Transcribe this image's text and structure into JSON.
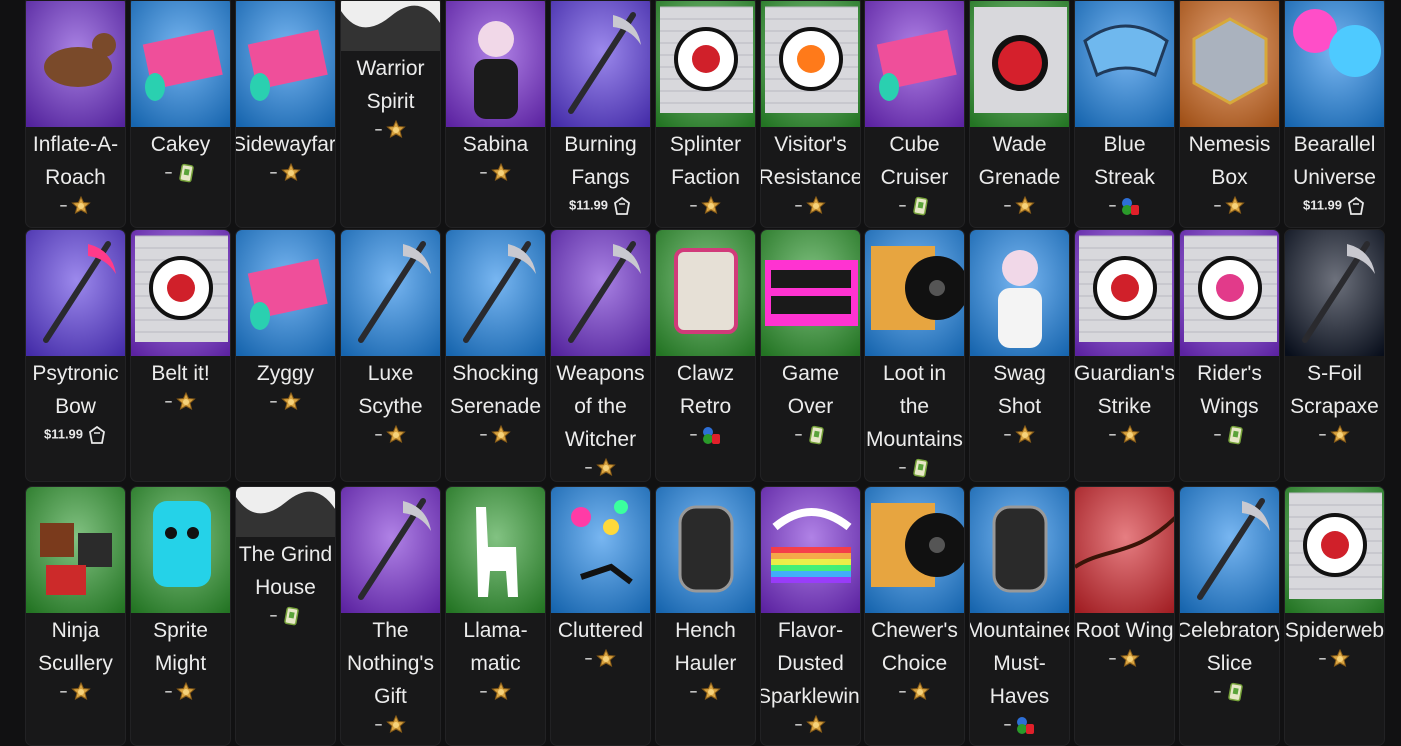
{
  "items": [
    {
      "name": "Inflate-A-Roach",
      "lines": [
        "Inflate-A-",
        "Roach"
      ],
      "price": "–",
      "source": "battle-pass",
      "bg": "#6f2fd0",
      "art": "roach-toy-icon"
    },
    {
      "name": "Cakey",
      "lines": [
        "Cakey"
      ],
      "price": "–",
      "source": "card",
      "bg": "#1e86e8",
      "art": "wrap-roll-icon"
    },
    {
      "name": "Sidewayfarer",
      "lines": [
        "Sidewayfarer"
      ],
      "price": "–",
      "source": "battle-pass",
      "bg": "#1e86e8",
      "art": "wrap-roll-icon"
    },
    {
      "name": "Warrior Spirit",
      "lines": [
        "Warrior",
        "Spirit"
      ],
      "price": "–",
      "source": "battle-pass",
      "bg": "#1a1a1a",
      "art": "ink-banner-icon"
    },
    {
      "name": "Sabina",
      "lines": [
        "Sabina"
      ],
      "price": "–",
      "source": "battle-pass",
      "bg": "#7b2fd6",
      "art": "character-icon"
    },
    {
      "name": "Burning Fangs",
      "lines": [
        "Burning",
        "Fangs"
      ],
      "price": "$11.99",
      "source": "shop",
      "bg": "#5a3be0",
      "art": "blades-icon"
    },
    {
      "name": "Splinter Faction",
      "lines": [
        "Splinter",
        "Faction"
      ],
      "price": "–",
      "source": "battle-pass",
      "bg": "#2e9a2e",
      "art": "spray-emblem-icon"
    },
    {
      "name": "Visitor's Resistance",
      "lines": [
        "Visitor's",
        "Resistance"
      ],
      "price": "–",
      "source": "battle-pass",
      "bg": "#2e9a2e",
      "art": "spray-fire-icon"
    },
    {
      "name": "Cube Cruiser",
      "lines": [
        "Cube",
        "Cruiser"
      ],
      "price": "–",
      "source": "card",
      "bg": "#7b2fd6",
      "art": "wrap-cube-icon"
    },
    {
      "name": "Wade Grenade",
      "lines": [
        "Wade",
        "Grenade"
      ],
      "price": "–",
      "source": "battle-pass",
      "bg": "#2e9a2e",
      "art": "grenade-spray-icon"
    },
    {
      "name": "Blue Streak",
      "lines": [
        "Blue",
        "Streak"
      ],
      "price": "–",
      "source": "console",
      "bg": "#1e86e8",
      "art": "glider-icon"
    },
    {
      "name": "Nemesis Box",
      "lines": [
        "Nemesis",
        "Box"
      ],
      "price": "–",
      "source": "battle-pass",
      "bg": "#d56b1f",
      "art": "box-icon"
    },
    {
      "name": "Bearallel Universe",
      "lines": [
        "Bearallel",
        "Universe"
      ],
      "price": "$11.99",
      "source": "shop",
      "bg": "#1e86e8",
      "art": "abstract-art-icon"
    },
    {
      "name": "Psytronic Bow",
      "lines": [
        "Psytronic",
        "Bow"
      ],
      "price": "$11.99",
      "source": "shop",
      "bg": "#5a3be0",
      "art": "bow-icon"
    },
    {
      "name": "Belt it!",
      "lines": [
        "Belt it!"
      ],
      "price": "–",
      "source": "battle-pass",
      "bg": "#7b2fd6",
      "art": "spray-singer-icon"
    },
    {
      "name": "Zyggy",
      "lines": [
        "Zyggy"
      ],
      "price": "–",
      "source": "battle-pass",
      "bg": "#1e86e8",
      "art": "wrap-roll-icon"
    },
    {
      "name": "Luxe Scythe",
      "lines": [
        "Luxe",
        "Scythe"
      ],
      "price": "–",
      "source": "battle-pass",
      "bg": "#1e86e8",
      "art": "scythe-icon"
    },
    {
      "name": "Shocking Serenade",
      "lines": [
        "Shocking",
        "Serenade"
      ],
      "price": "–",
      "source": "battle-pass",
      "bg": "#1e86e8",
      "art": "mic-stand-icon"
    },
    {
      "name": "Weapons of the Witcher",
      "lines": [
        "Weapons",
        "of the",
        "Witcher"
      ],
      "price": "–",
      "source": "battle-pass",
      "bg": "#6f2fd0",
      "art": "swords-icon"
    },
    {
      "name": "Clawz Retro",
      "lines": [
        "Clawz",
        "Retro"
      ],
      "price": "–",
      "source": "console",
      "bg": "#2e9a2e",
      "art": "claw-machine-icon"
    },
    {
      "name": "Game Over",
      "lines": [
        "Game",
        "Over"
      ],
      "price": "–",
      "source": "card",
      "bg": "#2e9a2e",
      "art": "game-over-icon"
    },
    {
      "name": "Loot in the Mountains",
      "lines": [
        "Loot in",
        "the",
        "Mountains"
      ],
      "price": "–",
      "source": "card",
      "bg": "#1e86e8",
      "art": "music-record-icon"
    },
    {
      "name": "Swag Shot",
      "lines": [
        "Swag",
        "Shot"
      ],
      "price": "–",
      "source": "battle-pass",
      "bg": "#1e86e8",
      "art": "emote-silhouette-icon"
    },
    {
      "name": "Guardian's Strike",
      "lines": [
        "Guardian's",
        "Strike"
      ],
      "price": "–",
      "source": "battle-pass",
      "bg": "#7b2fd6",
      "art": "spray-hero-icon"
    },
    {
      "name": "Rider's Wings",
      "lines": [
        "Rider's",
        "Wings"
      ],
      "price": "–",
      "source": "card",
      "bg": "#7b2fd6",
      "art": "spray-wings-icon"
    },
    {
      "name": "S-Foil Scrapaxe",
      "lines": [
        "S-Foil",
        "Scrapaxe"
      ],
      "price": "–",
      "source": "battle-pass",
      "bg": "#0b1324",
      "art": "axe-icon"
    },
    {
      "name": "Ninja Scullery",
      "lines": [
        "Ninja",
        "Scullery"
      ],
      "price": "–",
      "source": "battle-pass",
      "bg": "#2e9a2e",
      "art": "kitchen-icon"
    },
    {
      "name": "Sprite Might",
      "lines": [
        "Sprite",
        "Might"
      ],
      "price": "–",
      "source": "battle-pass",
      "bg": "#2e9a2e",
      "art": "sprite-icon"
    },
    {
      "name": "The Grind House",
      "lines": [
        "The Grind",
        "House"
      ],
      "price": "–",
      "source": "card",
      "bg": "#1a1a1a",
      "art": "ink-banner-icon"
    },
    {
      "name": "The Nothing's Gift",
      "lines": [
        "The",
        "Nothing's",
        "Gift"
      ],
      "price": "–",
      "source": "battle-pass",
      "bg": "#7b2fd6",
      "art": "dagger-icon"
    },
    {
      "name": "Llama-matic",
      "lines": [
        "Llama-",
        "matic"
      ],
      "price": "–",
      "source": "battle-pass",
      "bg": "#2e9a2e",
      "art": "llama-icon"
    },
    {
      "name": "Cluttered",
      "lines": [
        "Cluttered"
      ],
      "price": "–",
      "source": "battle-pass",
      "bg": "#1e86e8",
      "art": "skydive-trail-icon"
    },
    {
      "name": "Hench Hauler",
      "lines": [
        "Hench",
        "Hauler"
      ],
      "price": "–",
      "source": "battle-pass",
      "bg": "#1e86e8",
      "art": "backpack-icon"
    },
    {
      "name": "Flavor-Dusted Sparklewings",
      "lines": [
        "Flavor-",
        "Dusted",
        "Sparklewings"
      ],
      "price": "–",
      "source": "battle-pass",
      "bg": "#7b2fd6",
      "art": "rainbow-wings-icon"
    },
    {
      "name": "Chewer's Choice",
      "lines": [
        "Chewer's",
        "Choice"
      ],
      "price": "–",
      "source": "battle-pass",
      "bg": "#1e86e8",
      "art": "music-record-icon"
    },
    {
      "name": "Mountaineer's Must-Haves",
      "lines": [
        "Mountaineer's",
        "Must-",
        "Haves"
      ],
      "price": "–",
      "source": "console",
      "bg": "#1e86e8",
      "art": "backpack-icon"
    },
    {
      "name": "Root Wing",
      "lines": [
        "Root Wing"
      ],
      "price": "–",
      "source": "battle-pass",
      "bg": "#d6282e",
      "art": "contrail-icon"
    },
    {
      "name": "Celebratory Slice",
      "lines": [
        "Celebratory",
        "Slice"
      ],
      "price": "–",
      "source": "card",
      "bg": "#1e86e8",
      "art": "pickaxe-icon"
    },
    {
      "name": "Spiderweb",
      "lines": [
        "Spiderweb"
      ],
      "price": "–",
      "source": "battle-pass",
      "bg": "#2e9a2e",
      "art": "spray-web-icon"
    }
  ],
  "colors": {
    "page_bg": "#111112",
    "card_bg": "#181819",
    "text": "#ececec"
  }
}
